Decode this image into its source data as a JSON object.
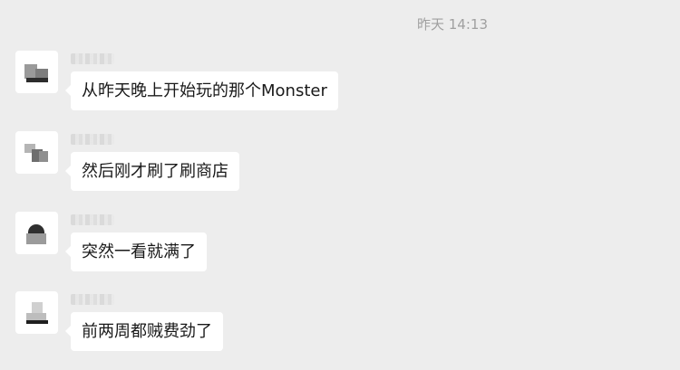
{
  "chat": {
    "timestamp": "昨天 14:13",
    "messages": [
      {
        "text": "从昨天晚上开始玩的那个Monster"
      },
      {
        "text": "然后刚才刷了刷商店"
      },
      {
        "text": "突然一看就满了"
      },
      {
        "text": "前两周都贼费劲了"
      }
    ]
  }
}
